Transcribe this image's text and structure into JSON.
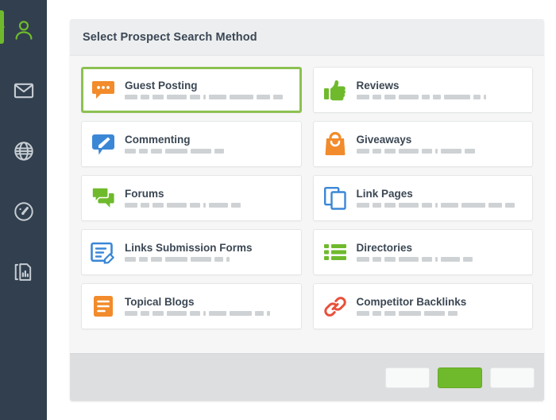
{
  "sidebar": {
    "items": [
      {
        "icon": "user-icon",
        "name": "sidebar-item-prospects",
        "active": true
      },
      {
        "icon": "envelope-icon",
        "name": "sidebar-item-mail",
        "active": false
      },
      {
        "icon": "globe-icon",
        "name": "sidebar-item-web",
        "active": false
      },
      {
        "icon": "speedometer-icon",
        "name": "sidebar-item-dashboard",
        "active": false
      },
      {
        "icon": "report-icon",
        "name": "sidebar-item-reports",
        "active": false
      }
    ],
    "colors": {
      "background": "#313f4e",
      "active": "#6fba2c",
      "idle": "#c7cdd3"
    }
  },
  "panel": {
    "header": {
      "title": "Select Prospect Search Method"
    },
    "cards": [
      {
        "title": "Guest Posting",
        "icon": "speech-bubble-dots-icon",
        "color": "#f28b2b",
        "selected": true,
        "desc_widths": [
          16,
          11,
          14,
          25,
          13,
          3,
          22,
          30,
          17,
          12
        ]
      },
      {
        "title": "Reviews",
        "icon": "thumbs-up-icon",
        "color": "#6fba2c",
        "selected": false,
        "desc_widths": [
          16,
          11,
          14,
          25,
          10,
          10,
          33,
          9,
          3
        ]
      },
      {
        "title": "Commenting",
        "icon": "comment-pencil-icon",
        "color": "#3b87d6",
        "selected": false,
        "desc_widths": [
          14,
          11,
          14,
          28,
          26,
          12
        ]
      },
      {
        "title": "Giveaways",
        "icon": "gift-bag-icon",
        "color": "#f28b2b",
        "selected": false,
        "desc_widths": [
          16,
          11,
          14,
          25,
          13,
          3,
          26,
          13
        ]
      },
      {
        "title": "Forums",
        "icon": "forum-bubbles-icon",
        "color": "#6fba2c",
        "selected": false,
        "desc_widths": [
          16,
          11,
          14,
          25,
          13,
          3,
          24,
          12
        ]
      },
      {
        "title": "Link Pages",
        "icon": "copy-pages-icon",
        "color": "#3b87d6",
        "selected": false,
        "desc_widths": [
          16,
          11,
          14,
          25,
          13,
          3,
          22,
          30,
          17,
          12
        ]
      },
      {
        "title": "Links Submission Forms",
        "icon": "form-edit-icon",
        "color": "#3b87d6",
        "selected": false,
        "desc_widths": [
          14,
          11,
          14,
          28,
          26,
          11,
          4
        ]
      },
      {
        "title": "Directories",
        "icon": "list-grid-icon",
        "color": "#6fba2c",
        "selected": false,
        "desc_widths": [
          16,
          11,
          14,
          25,
          13,
          3,
          24,
          12
        ]
      },
      {
        "title": "Topical Blogs",
        "icon": "document-lines-icon",
        "color": "#f28b2b",
        "selected": false,
        "desc_widths": [
          16,
          11,
          14,
          25,
          13,
          3,
          22,
          28,
          11,
          4
        ]
      },
      {
        "title": "Competitor Backlinks",
        "icon": "chain-link-icon",
        "color": "#e8503a",
        "selected": false,
        "desc_widths": [
          16,
          11,
          14,
          28,
          26,
          12
        ]
      }
    ],
    "footer": {
      "buttons": [
        {
          "name": "footer-button-back",
          "label": "",
          "primary": false
        },
        {
          "name": "footer-button-next",
          "label": "",
          "primary": true
        },
        {
          "name": "footer-button-cancel",
          "label": "",
          "primary": false
        }
      ]
    }
  }
}
